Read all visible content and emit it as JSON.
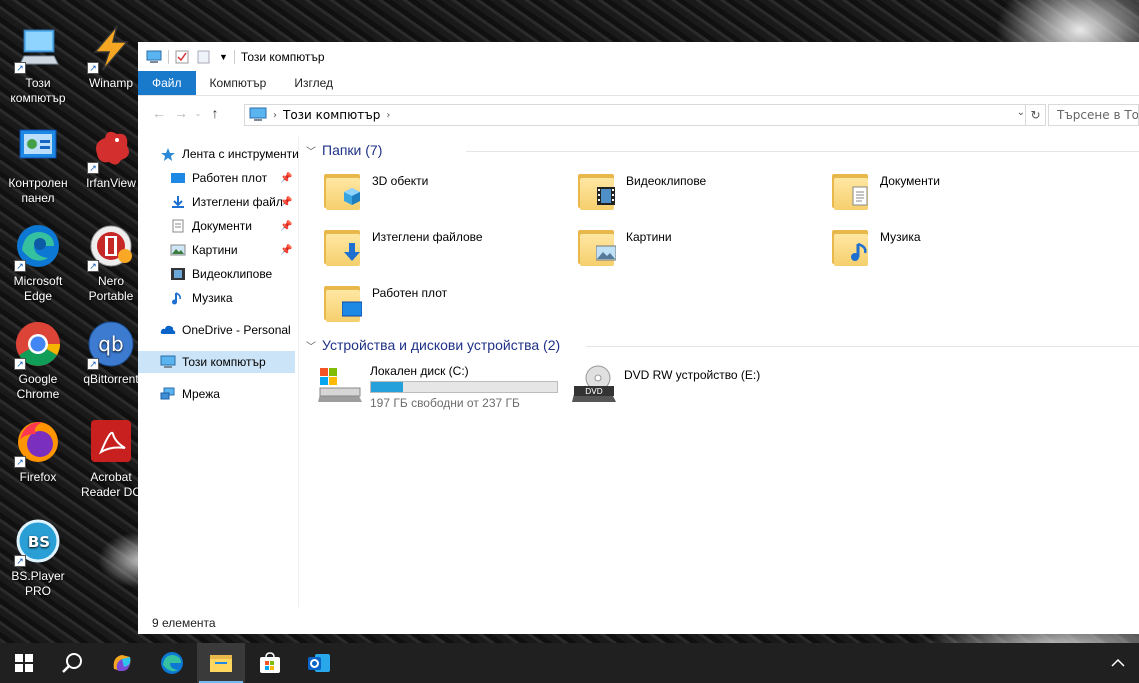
{
  "desktop": {
    "icons": [
      {
        "label": "Този\nкомпютър"
      },
      {
        "label": "Winamp"
      },
      {
        "label": "Контролен\nпанел"
      },
      {
        "label": "IrfanView"
      },
      {
        "label": "Microsoft\nEdge"
      },
      {
        "label": "Nero\nPortable"
      },
      {
        "label": "Google\nChrome"
      },
      {
        "label": "qBittorrent"
      },
      {
        "label": "Firefox"
      },
      {
        "label": "Acrobat\nReader DC"
      },
      {
        "label": "BS.Player\nPRO"
      }
    ]
  },
  "window": {
    "title": "Този компютър",
    "ribbon_tabs": [
      "Файл",
      "Компютър",
      "Изглед"
    ],
    "address": {
      "path": "Този компютър"
    },
    "search": {
      "placeholder": "Търсене в Този компютър"
    },
    "nav": {
      "quick_access": "Лента с инструменти",
      "items": [
        "Работен плот",
        "Изтеглени файл",
        "Документи",
        "Картини",
        "Видеоклипове",
        "Музика"
      ],
      "onedrive": "OneDrive - Personal",
      "this_pc": "Този компютър",
      "network": "Мрежа"
    },
    "folders_group": "Папки (7)",
    "folders": [
      "3D обекти",
      "Видеоклипове",
      "Документи",
      "Изтеглени файлове",
      "Картини",
      "Музика",
      "Работен плот"
    ],
    "devices_group": "Устройства и дискови устройства (2)",
    "drives": [
      {
        "name": "Локален диск (C:)",
        "free": "197 ГБ свободни от 237 ГБ",
        "used_fraction": 0.17
      },
      {
        "name": "DVD RW устройство (E:)"
      }
    ],
    "status": "9 елемента"
  },
  "taskbar": {
    "items": [
      "start",
      "search",
      "copilot",
      "edge",
      "file-explorer",
      "store",
      "outlook"
    ]
  },
  "colors": {
    "accent": "#1979ca",
    "selection": "#cce4f7",
    "group_header": "#1e3287",
    "drive_bar": "#26a0da"
  }
}
